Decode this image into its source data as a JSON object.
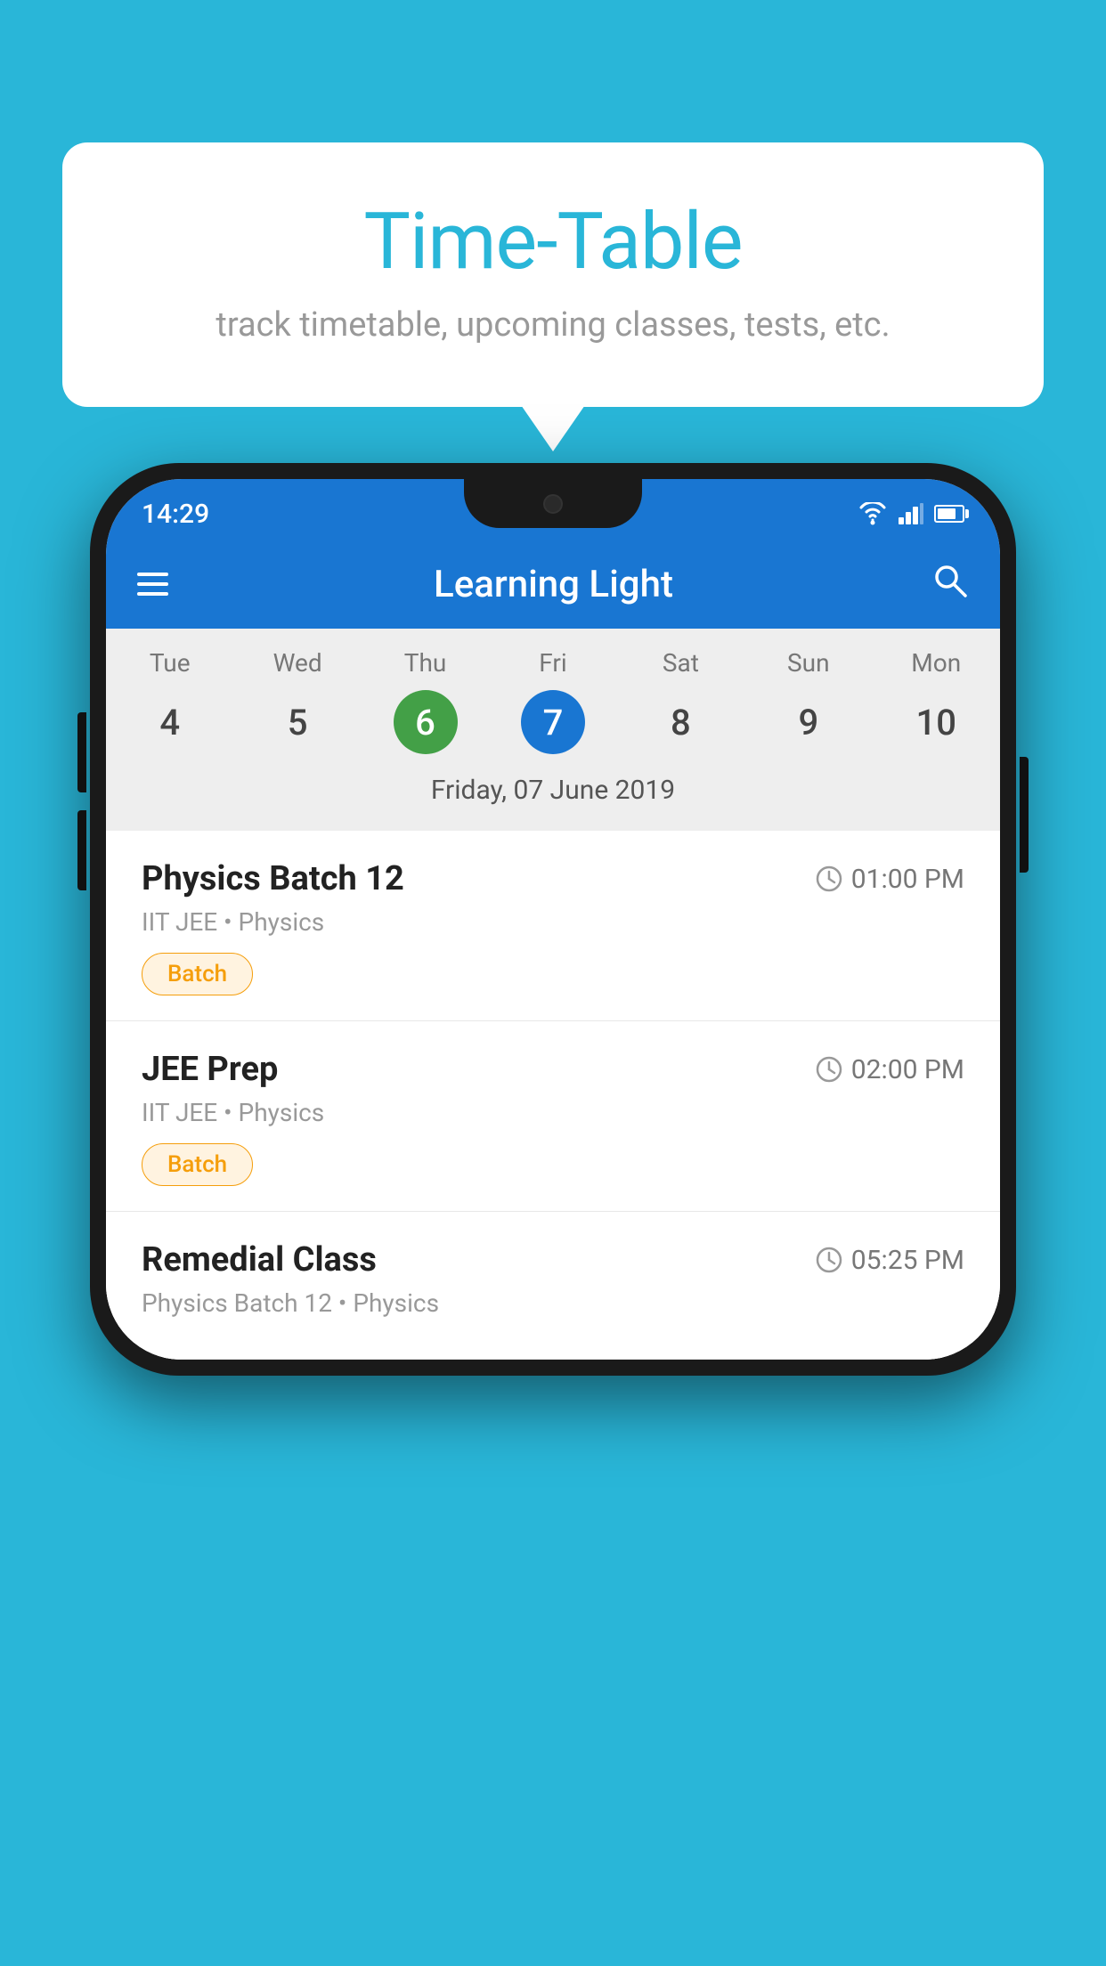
{
  "background_color": "#29b6d8",
  "speech_bubble": {
    "title": "Time-Table",
    "subtitle": "track timetable, upcoming classes, tests, etc."
  },
  "phone": {
    "status_bar": {
      "time": "14:29"
    },
    "toolbar": {
      "title": "Learning Light",
      "menu_icon_label": "menu",
      "search_icon_label": "search"
    },
    "calendar": {
      "days": [
        {
          "name": "Tue",
          "num": "4",
          "state": "normal"
        },
        {
          "name": "Wed",
          "num": "5",
          "state": "normal"
        },
        {
          "name": "Thu",
          "num": "6",
          "state": "today"
        },
        {
          "name": "Fri",
          "num": "7",
          "state": "selected"
        },
        {
          "name": "Sat",
          "num": "8",
          "state": "normal"
        },
        {
          "name": "Sun",
          "num": "9",
          "state": "normal"
        },
        {
          "name": "Mon",
          "num": "10",
          "state": "normal"
        }
      ],
      "selected_date_label": "Friday, 07 June 2019"
    },
    "classes": [
      {
        "title": "Physics Batch 12",
        "time": "01:00 PM",
        "subtitle": "IIT JEE • Physics",
        "badge": "Batch"
      },
      {
        "title": "JEE Prep",
        "time": "02:00 PM",
        "subtitle": "IIT JEE • Physics",
        "badge": "Batch"
      },
      {
        "title": "Remedial Class",
        "time": "05:25 PM",
        "subtitle": "Physics Batch 12 • Physics",
        "badge": ""
      }
    ]
  }
}
